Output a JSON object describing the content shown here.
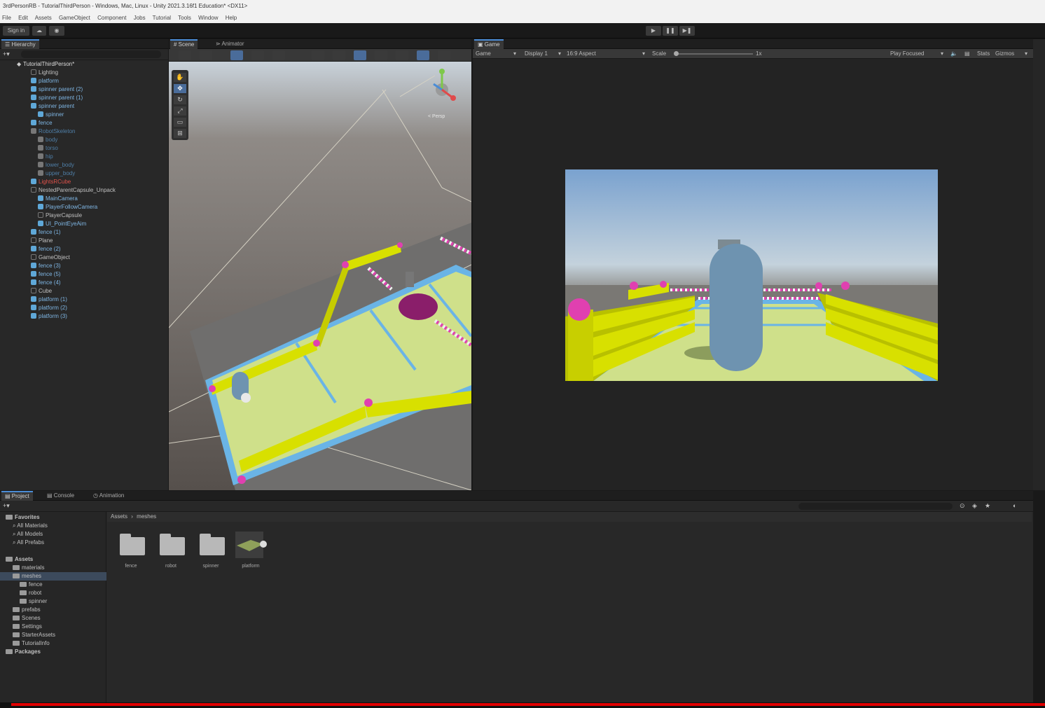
{
  "window": {
    "title": "3rdPersonRB - TutorialThirdPerson - Windows, Mac, Linux - Unity 2021.3.16f1 Education* <DX11>"
  },
  "menu": [
    "File",
    "Edit",
    "Assets",
    "GameObject",
    "Component",
    "Jobs",
    "Tutorial",
    "Tools",
    "Window",
    "Help"
  ],
  "toolbar": {
    "sign_in": "Sign in"
  },
  "hierarchy": {
    "tab": "Hierarchy",
    "root": "TutorialThirdPerson*",
    "items": [
      {
        "label": "Lighting",
        "depth": 1,
        "icon": "empty"
      },
      {
        "label": "platform",
        "depth": 1,
        "icon": "cube"
      },
      {
        "label": "spinner parent (2)",
        "depth": 1,
        "icon": "cube"
      },
      {
        "label": "spinner parent (1)",
        "depth": 1,
        "icon": "cube"
      },
      {
        "label": "spinner parent",
        "depth": 1,
        "icon": "cube"
      },
      {
        "label": "spinner",
        "depth": 2,
        "icon": "cube"
      },
      {
        "label": "fence",
        "depth": 1,
        "icon": "cube"
      },
      {
        "label": "RobotSkeleton",
        "depth": 1,
        "icon": "grey",
        "dim": true
      },
      {
        "label": "body",
        "depth": 2,
        "icon": "grey",
        "dim": true
      },
      {
        "label": "torso",
        "depth": 2,
        "icon": "grey",
        "dim": true
      },
      {
        "label": "hip",
        "depth": 2,
        "icon": "grey",
        "dim": true
      },
      {
        "label": "lower_body",
        "depth": 2,
        "icon": "grey",
        "dim": true
      },
      {
        "label": "upper_body",
        "depth": 2,
        "icon": "grey",
        "dim": true
      },
      {
        "label": "LightsRCube",
        "depth": 1,
        "icon": "cube",
        "color": "#e0524a"
      },
      {
        "label": "NestedParentCapsule_Unpack",
        "depth": 1,
        "icon": "empty"
      },
      {
        "label": "MainCamera",
        "depth": 2,
        "icon": "cube"
      },
      {
        "label": "PlayerFollowCamera",
        "depth": 2,
        "icon": "cube"
      },
      {
        "label": "PlayerCapsule",
        "depth": 2,
        "icon": "empty"
      },
      {
        "label": "UI_PointEyeAim",
        "depth": 2,
        "icon": "cube"
      },
      {
        "label": "fence (1)",
        "depth": 1,
        "icon": "cube"
      },
      {
        "label": "Plane",
        "depth": 1,
        "icon": "empty"
      },
      {
        "label": "fence (2)",
        "depth": 1,
        "icon": "cube"
      },
      {
        "label": "GameObject",
        "depth": 1,
        "icon": "empty"
      },
      {
        "label": "fence (3)",
        "depth": 1,
        "icon": "cube"
      },
      {
        "label": "fence (5)",
        "depth": 1,
        "icon": "cube"
      },
      {
        "label": "fence (4)",
        "depth": 1,
        "icon": "cube"
      },
      {
        "label": "Cube",
        "depth": 1,
        "icon": "empty"
      },
      {
        "label": "platform (1)",
        "depth": 1,
        "icon": "cube"
      },
      {
        "label": "platform (2)",
        "depth": 1,
        "icon": "cube"
      },
      {
        "label": "platform (3)",
        "depth": 1,
        "icon": "cube"
      }
    ]
  },
  "scene": {
    "tabs": [
      "Scene",
      "Animator"
    ],
    "persp_label": "< Persp"
  },
  "game": {
    "tab": "Game",
    "mode": "Game",
    "display": "Display 1",
    "aspect": "16:9 Aspect",
    "scale_label": "Scale",
    "scale_value": "1x",
    "play_focused": "Play Focused",
    "stats": "Stats",
    "gizmos": "Gizmos"
  },
  "bottom": {
    "tabs": [
      "Project",
      "Console",
      "Animation"
    ],
    "breadcrumb": [
      "Assets",
      "meshes"
    ],
    "tree": [
      {
        "label": "Favorites",
        "depth": 0,
        "bold": true
      },
      {
        "label": "All Materials",
        "depth": 1
      },
      {
        "label": "All Models",
        "depth": 1
      },
      {
        "label": "All Prefabs",
        "depth": 1
      },
      {
        "label": "Assets",
        "depth": 0,
        "bold": true,
        "gap": true
      },
      {
        "label": "materials",
        "depth": 1
      },
      {
        "label": "meshes",
        "depth": 1,
        "selected": true
      },
      {
        "label": "fence",
        "depth": 2
      },
      {
        "label": "robot",
        "depth": 2
      },
      {
        "label": "spinner",
        "depth": 2
      },
      {
        "label": "prefabs",
        "depth": 1
      },
      {
        "label": "Scenes",
        "depth": 1
      },
      {
        "label": "Settings",
        "depth": 1
      },
      {
        "label": "StarterAssets",
        "depth": 1
      },
      {
        "label": "TutorialInfo",
        "depth": 1
      },
      {
        "label": "Packages",
        "depth": 0,
        "bold": true
      }
    ],
    "assets": [
      {
        "label": "fence",
        "kind": "folder"
      },
      {
        "label": "robot",
        "kind": "folder"
      },
      {
        "label": "spinner",
        "kind": "folder"
      },
      {
        "label": "platform",
        "kind": "mesh"
      }
    ]
  },
  "colors": {
    "accent": "#4a8cd6",
    "fence_yellow": "#d8e000",
    "platform_green": "#cfe08a",
    "platform_border": "#6ab4e6",
    "capsule": "#6e93b0",
    "spinner": "#8a1e6a",
    "pink_ball": "#e040b0",
    "progress_red": "#e00000"
  }
}
